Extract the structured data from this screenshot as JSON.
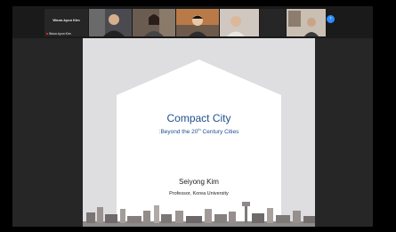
{
  "participants": [
    {
      "name": "Woon-kyun Kim",
      "label": "Woon-kyun Kim",
      "video": false
    },
    {
      "name": "",
      "label": "",
      "video": true,
      "bg": "#4b4a50"
    },
    {
      "name": "",
      "label": "",
      "video": true,
      "bg": "#6b5c52"
    },
    {
      "name": "",
      "label": "",
      "video": true,
      "bg": "#b97a48"
    },
    {
      "name": "",
      "label": "",
      "video": true,
      "bg": "#cfc7c0"
    },
    {
      "name": "",
      "label": "",
      "video": false
    },
    {
      "name": "",
      "label": "",
      "video": true,
      "bg": "#c9bfb3"
    }
  ],
  "gallery_next": "›",
  "slide": {
    "title": "Compact City",
    "subtitle_prefix": ":Beyond the 20",
    "subtitle_sup": "th",
    "subtitle_suffix": " Century Cities",
    "author": "Seiyong Kim",
    "affiliation": "Professor, Korea University"
  }
}
